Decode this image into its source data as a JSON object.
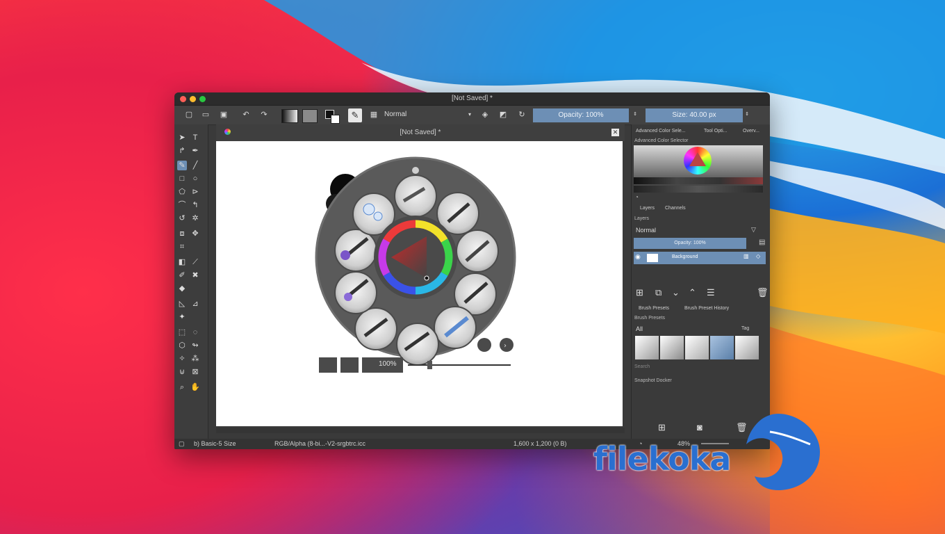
{
  "window": {
    "title": "[Not Saved]  *",
    "document_tab": "[Not Saved]  *"
  },
  "toolbar": {
    "blend_mode": "Normal",
    "opacity": "Opacity: 100%",
    "size": "Size: 40.00 px"
  },
  "popup": {
    "zoom_label": "100%"
  },
  "dock": {
    "tabs": [
      "Advanced Color Sele...",
      "Tool Opti...",
      "Overv..."
    ],
    "color_selector_title": "Advanced Color Selector",
    "layers_tabs": [
      "Layers",
      "Channels"
    ],
    "layers_title": "Layers",
    "layer_blend": "Normal",
    "layer_opacity": "Opacity:  100%",
    "layer_name": "Background",
    "brush_tabs": [
      "Brush Presets",
      "Brush Preset History"
    ],
    "brush_presets_title": "Brush Presets",
    "brush_filter": "All",
    "tag_label": "Tag",
    "search_placeholder": "Search",
    "snapshot_title": "Snapshot Docker"
  },
  "status": {
    "brush": "b) Basic-5 Size",
    "color_space": "RGB/Alpha (8-bi...-V2-srgbtrc.icc",
    "dimensions": "1,600 x 1,200 (0 B)",
    "zoom": "48%"
  },
  "watermark": {
    "text": "filekoka"
  },
  "colors": {
    "accent": "#6d8fb5",
    "window_bg": "#3a3a3a",
    "logo": "#2a6fd0"
  }
}
